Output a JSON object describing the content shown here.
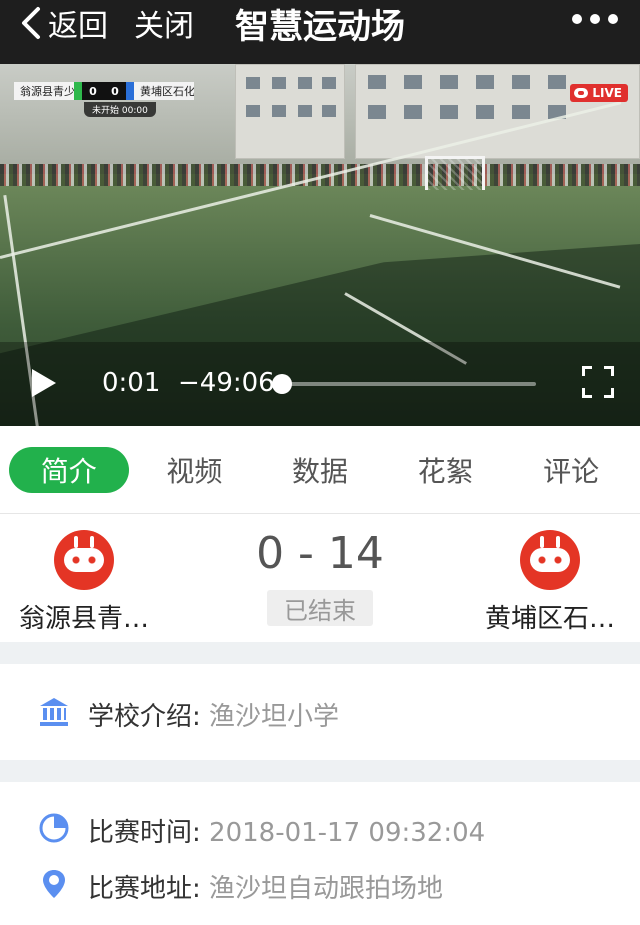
{
  "nav": {
    "back_label": "返回",
    "close_label": "关闭",
    "title": "智慧运动场"
  },
  "video": {
    "scoreboard": {
      "home_team": "翁源县青少年宫",
      "home_score": "0",
      "away_score": "0",
      "away_team": "黄埔区石化小学",
      "status": "未开始 00:00"
    },
    "live_label": "LIVE",
    "current_time": "0:01",
    "remaining_time": "−49:06",
    "progress_fraction": 0.0
  },
  "tabs": [
    {
      "label": "简介",
      "active": true
    },
    {
      "label": "视频",
      "active": false
    },
    {
      "label": "数据",
      "active": false
    },
    {
      "label": "花絮",
      "active": false
    },
    {
      "label": "评论",
      "active": false
    }
  ],
  "match": {
    "home_team": "翁源县青…",
    "away_team": "黄埔区石…",
    "score": "0 - 14",
    "status": "已结束"
  },
  "info": {
    "school_label": "学校介绍:",
    "school_value": "渔沙坦小学",
    "time_label": "比赛时间:",
    "time_value": "2018-01-17 09:32:04",
    "address_label": "比赛地址:",
    "address_value": "渔沙坦自动跟拍场地"
  },
  "colors": {
    "accent_green": "#22b14c",
    "logo_red": "#e43525",
    "live_red": "#e0302e",
    "icon_blue": "#5b8ff0"
  },
  "icons": [
    "chevron-left-icon",
    "more-icon",
    "play-icon",
    "fullscreen-icon",
    "bank-icon",
    "clock-icon",
    "location-pin-icon"
  ]
}
